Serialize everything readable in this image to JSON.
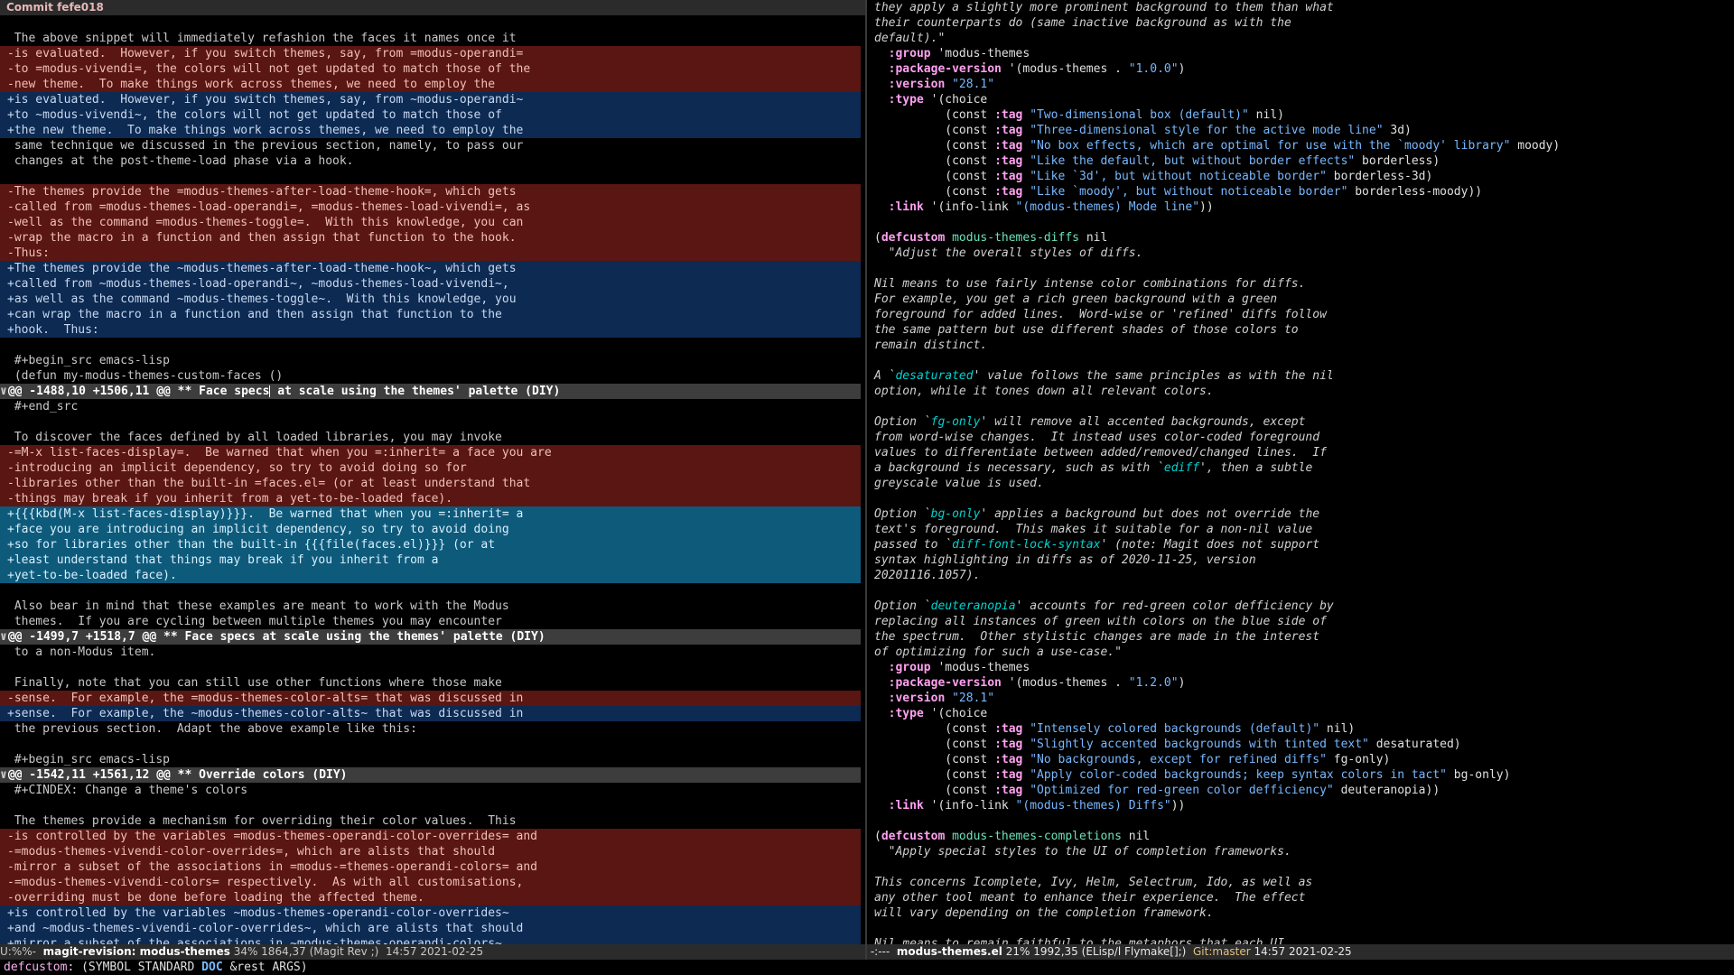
{
  "left": {
    "header": "Commit fefe018",
    "lines": [
      {
        "t": "blank",
        "text": ""
      },
      {
        "t": "ctx",
        "text": " The above snippet will immediately refashion the faces it names once it"
      },
      {
        "t": "del",
        "text": "-is evaluated.  However, if you switch themes, say, from =modus-operandi="
      },
      {
        "t": "del",
        "text": "-to =modus-vivendi=, the colors will not get updated to match those of the"
      },
      {
        "t": "del",
        "text": "-new theme.  To make things work across themes, we need to employ the"
      },
      {
        "t": "add",
        "text": "+is evaluated.  However, if you switch themes, say, from ~modus-operandi~"
      },
      {
        "t": "add",
        "text": "+to ~modus-vivendi~, the colors will not get updated to match those of"
      },
      {
        "t": "add",
        "text": "+the new theme.  To make things work across themes, we need to employ the"
      },
      {
        "t": "ctx",
        "text": " same technique we discussed in the previous section, namely, to pass our"
      },
      {
        "t": "ctx",
        "text": " changes at the post-theme-load phase via a hook."
      },
      {
        "t": "blank",
        "text": ""
      },
      {
        "t": "del",
        "text": "-The themes provide the =modus-themes-after-load-theme-hook=, which gets"
      },
      {
        "t": "del",
        "text": "-called from =modus-themes-load-operandi=, =modus-themes-load-vivendi=, as"
      },
      {
        "t": "del",
        "text": "-well as the command =modus-themes-toggle=.  With this knowledge, you can"
      },
      {
        "t": "del",
        "text": "-wrap the macro in a function and then assign that function to the hook."
      },
      {
        "t": "del",
        "text": "-Thus:"
      },
      {
        "t": "add",
        "text": "+The themes provide the ~modus-themes-after-load-theme-hook~, which gets"
      },
      {
        "t": "add",
        "text": "+called from ~modus-themes-load-operandi~, ~modus-themes-load-vivendi~,"
      },
      {
        "t": "add",
        "text": "+as well as the command ~modus-themes-toggle~.  With this knowledge, you"
      },
      {
        "t": "add",
        "text": "+can wrap the macro in a function and then assign that function to the"
      },
      {
        "t": "add",
        "text": "+hook.  Thus:"
      },
      {
        "t": "blank",
        "text": ""
      },
      {
        "t": "ctx",
        "text": " #+begin_src emacs-lisp"
      },
      {
        "t": "ctx",
        "text": " (defun my-modus-themes-custom-faces ()"
      },
      {
        "t": "hunk",
        "text": "@@ -1488,10 +1506,11 @@ ** Face specs at scale using the themes' palette (DIY)"
      },
      {
        "t": "ctx",
        "text": " #+end_src"
      },
      {
        "t": "blank",
        "text": ""
      },
      {
        "t": "ctx",
        "text": " To discover the faces defined by all loaded libraries, you may invoke"
      },
      {
        "t": "del",
        "text": "-=M-x list-faces-display=.  Be warned that when you =:inherit= a face you are"
      },
      {
        "t": "del",
        "text": "-introducing an implicit dependency, so try to avoid doing so for"
      },
      {
        "t": "del",
        "text": "-libraries other than the built-in =faces.el= (or at least understand that"
      },
      {
        "t": "del",
        "text": "-things may break if you inherit from a yet-to-be-loaded face)."
      },
      {
        "t": "add-hl",
        "text": "+{{{kbd(M-x list-faces-display)}}}.  Be warned that when you =:inherit= a"
      },
      {
        "t": "add-hl",
        "text": "+face you are introducing an implicit dependency, so try to avoid doing"
      },
      {
        "t": "add-hl",
        "text": "+so for libraries other than the built-in {{{file(faces.el)}}} (or at"
      },
      {
        "t": "add-hl",
        "text": "+least understand that things may break if you inherit from a"
      },
      {
        "t": "add-hl",
        "text": "+yet-to-be-loaded face)."
      },
      {
        "t": "blank",
        "text": ""
      },
      {
        "t": "ctx",
        "text": " Also bear in mind that these examples are meant to work with the Modus"
      },
      {
        "t": "ctx",
        "text": " themes.  If you are cycling between multiple themes you may encounter"
      },
      {
        "t": "hunk",
        "text": "@@ -1499,7 +1518,7 @@ ** Face specs at scale using the themes' palette (DIY)"
      },
      {
        "t": "ctx",
        "text": " to a non-Modus item."
      },
      {
        "t": "blank",
        "text": ""
      },
      {
        "t": "ctx",
        "text": " Finally, note that you can still use other functions where those make"
      },
      {
        "t": "del",
        "text": "-sense.  For example, the =modus-themes-color-alts= that was discussed in"
      },
      {
        "t": "add",
        "text": "+sense.  For example, the ~modus-themes-color-alts~ that was discussed in"
      },
      {
        "t": "ctx",
        "text": " the previous section.  Adapt the above example like this:"
      },
      {
        "t": "blank",
        "text": ""
      },
      {
        "t": "ctx",
        "text": " #+begin_src emacs-lisp"
      },
      {
        "t": "hunk",
        "text": "@@ -1542,11 +1561,12 @@ ** Override colors (DIY)"
      },
      {
        "t": "ctx",
        "text": " #+CINDEX: Change a theme's colors"
      },
      {
        "t": "blank",
        "text": ""
      },
      {
        "t": "ctx",
        "text": " The themes provide a mechanism for overriding their color values.  This"
      },
      {
        "t": "del",
        "text": "-is controlled by the variables =modus-themes-operandi-color-overrides= and"
      },
      {
        "t": "del",
        "text": "-=modus-themes-vivendi-color-overrides=, which are alists that should"
      },
      {
        "t": "del",
        "text": "-mirror a subset of the associations in =modus-=themes-operandi-colors= and"
      },
      {
        "t": "del",
        "text": "-=modus-themes-vivendi-colors= respectively.  As with all customisations,"
      },
      {
        "t": "del",
        "text": "-overriding must be done before loading the affected theme."
      },
      {
        "t": "add",
        "text": "+is controlled by the variables ~modus-themes-operandi-color-overrides~"
      },
      {
        "t": "add",
        "text": "+and ~modus-themes-vivendi-color-overrides~, which are alists that should"
      },
      {
        "t": "add",
        "text": "+mirror a subset of the associations in ~modus-themes-operandi-colors~"
      }
    ]
  },
  "right": {
    "lines": [
      {
        "h": "<span class='doc'>they apply a slightly more prominent background to them than what</span>"
      },
      {
        "h": "<span class='doc'>their counterparts do (same inactive background as with the</span>"
      },
      {
        "h": "<span class='doc'>default).\"</span>"
      },
      {
        "h": "  <span class='kw'>:group</span> 'modus-themes"
      },
      {
        "h": "  <span class='kw'>:package-version</span> '(modus-themes . <span class='str'>\"1.0.0\"</span>)"
      },
      {
        "h": "  <span class='kw'>:version</span> <span class='str'>\"28.1\"</span>"
      },
      {
        "h": "  <span class='kw'>:type</span> '(choice"
      },
      {
        "h": "          (const <span class='kw'>:tag</span> <span class='str'>\"Two-dimensional box (default)\"</span> nil)"
      },
      {
        "h": "          (const <span class='kw'>:tag</span> <span class='str'>\"Three-dimensional style for the active mode line\"</span> 3d)"
      },
      {
        "h": "          (const <span class='kw'>:tag</span> <span class='str'>\"No box effects, which are optimal for use with the `moody' library\"</span> moody)"
      },
      {
        "h": "          (const <span class='kw'>:tag</span> <span class='str'>\"Like the default, but without border effects\"</span> borderless)"
      },
      {
        "h": "          (const <span class='kw'>:tag</span> <span class='str'>\"Like `3d', but without noticeable border\"</span> borderless-3d)"
      },
      {
        "h": "          (const <span class='kw'>:tag</span> <span class='str'>\"Like `moody', but without noticeable border\"</span> borderless-moody))"
      },
      {
        "h": "  <span class='kw'>:link</span> '(info-link <span class='str'>\"(modus-themes) Mode line\"</span>))"
      },
      {
        "h": ""
      },
      {
        "h": "(<span class='kw'>defcustom</span> <span class='fn'>modus-themes-diffs</span> nil"
      },
      {
        "h": "  <span class='doc'>\"Adjust the overall styles of diffs.</span>"
      },
      {
        "h": ""
      },
      {
        "h": "<span class='doc'>Nil means to use fairly intense color combinations for diffs.</span>"
      },
      {
        "h": "<span class='doc'>For example, you get a rich green background with a green</span>"
      },
      {
        "h": "<span class='doc'>foreground for added lines.  Word-wise or 'refined' diffs follow</span>"
      },
      {
        "h": "<span class='doc'>the same pattern but use different shades of those colors to</span>"
      },
      {
        "h": "<span class='doc'>remain distinct.</span>"
      },
      {
        "h": ""
      },
      {
        "h": "<span class='doc'>A `<span class='ref'>desaturated</span>' value follows the same principles as with the nil</span>"
      },
      {
        "h": "<span class='doc'>option, while it tones down all relevant colors.</span>"
      },
      {
        "h": ""
      },
      {
        "h": "<span class='doc'>Option `<span class='ref'>fg-only</span>' will remove all accented backgrounds, except</span>"
      },
      {
        "h": "<span class='doc'>from word-wise changes.  It instead uses color-coded foreground</span>"
      },
      {
        "h": "<span class='doc'>values to differentiate between added/removed/changed lines.  If</span>"
      },
      {
        "h": "<span class='doc'>a background is necessary, such as with `<span class='ref'>ediff</span>', then a subtle</span>"
      },
      {
        "h": "<span class='doc'>greyscale value is used.</span>"
      },
      {
        "h": ""
      },
      {
        "h": "<span class='doc'>Option `<span class='ref'>bg-only</span>' applies a background but does not override the</span>"
      },
      {
        "h": "<span class='doc'>text's foreground.  This makes it suitable for a non-nil value</span>"
      },
      {
        "h": "<span class='doc'>passed to `<span class='ref'>diff-font-lock-syntax</span>' (note: Magit does not support</span>"
      },
      {
        "h": "<span class='doc'>syntax highlighting in diffs as of 2020-11-25, version</span>"
      },
      {
        "h": "<span class='doc'>20201116.1057).</span>"
      },
      {
        "h": ""
      },
      {
        "h": "<span class='doc'>Option `<span class='ref'>deuteranopia</span>' accounts for red-green color defficiency by</span>"
      },
      {
        "h": "<span class='doc'>replacing all instances of green with colors on the blue side of</span>"
      },
      {
        "h": "<span class='doc'>the spectrum.  Other stylistic changes are made in the interest</span>"
      },
      {
        "h": "<span class='doc'>of optimizing for such a use-case.\"</span>"
      },
      {
        "h": "  <span class='kw'>:group</span> 'modus-themes"
      },
      {
        "h": "  <span class='kw'>:package-version</span> '(modus-themes . <span class='str'>\"1.2.0\"</span>)"
      },
      {
        "h": "  <span class='kw'>:version</span> <span class='str'>\"28.1\"</span>"
      },
      {
        "h": "  <span class='kw'>:type</span> '(choice"
      },
      {
        "h": "          (const <span class='kw'>:tag</span> <span class='str'>\"Intensely colored backgrounds (default)\"</span> nil)"
      },
      {
        "h": "          (const <span class='kw'>:tag</span> <span class='str'>\"Slightly accented backgrounds with tinted text\"</span> desaturated)"
      },
      {
        "h": "          (const <span class='kw'>:tag</span> <span class='str'>\"No backgrounds, except for refined diffs\"</span> fg-only)"
      },
      {
        "h": "          (const <span class='kw'>:tag</span> <span class='str'>\"Apply color-coded backgrounds; keep syntax colors in tact\"</span> bg-only)"
      },
      {
        "h": "          (const <span class='kw'>:tag</span> <span class='str'>\"Optimized for red-green color defficiency\"</span> deuteranopia))"
      },
      {
        "h": "  <span class='kw'>:link</span> '(info-link <span class='str'>\"(modus-themes) Diffs\"</span>))"
      },
      {
        "h": ""
      },
      {
        "h": "(<span class='kw'>defcustom</span> <span class='fn'>modus-themes-completions</span> nil"
      },
      {
        "h": "  <span class='doc'>\"Apply special styles to the UI of completion frameworks.</span>"
      },
      {
        "h": ""
      },
      {
        "h": "<span class='doc'>This concerns Icomplete, Ivy, Helm, Selectrum, Ido, as well as</span>"
      },
      {
        "h": "<span class='doc'>any other tool meant to enhance their experience.  The effect</span>"
      },
      {
        "h": "<span class='doc'>will vary depending on the completion framework.</span>"
      },
      {
        "h": ""
      },
      {
        "h": "<span class='doc'>Nil means to remain faithful to the metaphors that each UI</span>"
      }
    ]
  },
  "modeline_left": {
    "state": "U:%%-",
    "buffer": "magit-revision: modus-themes",
    "position": "34% 1864,37",
    "mode": "(Magit Rev ;)",
    "time": "14:57",
    "date": "2021-02-25"
  },
  "modeline_right": {
    "state": "-:---",
    "buffer": "modus-themes.el",
    "position": "21% 1992,35",
    "mode": "(ELisp/l Flymake[];)",
    "vc": "Git:master",
    "time": "14:57",
    "date": "2021-02-25"
  },
  "echo": {
    "fn": "defcustom",
    "pre": ": (SYMBOL STANDARD ",
    "doc": "DOC",
    "post": " &rest ARGS)"
  },
  "colors": {
    "removed_bg": "#5a1612",
    "added_bg": "#0c2a52",
    "added_refined_bg": "#0e5a7a",
    "hunk_bg": "#3d3d3d",
    "keyword": "#ffa0f0",
    "string": "#78b8ff"
  }
}
